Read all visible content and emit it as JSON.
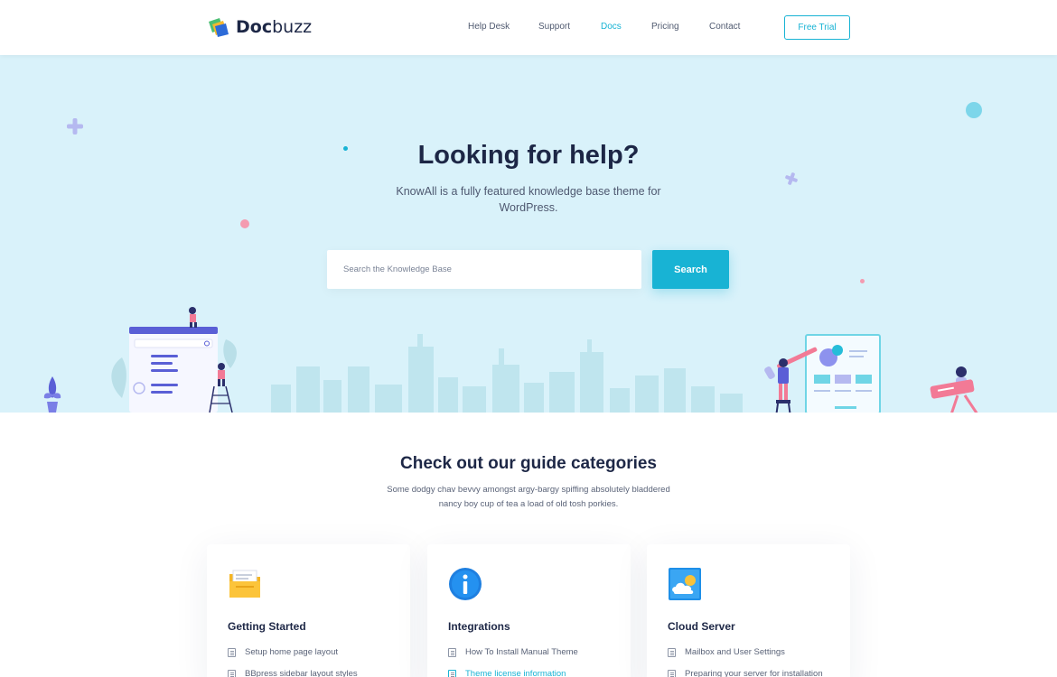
{
  "brand": {
    "name_bold": "Doc",
    "name_rest": "buzz"
  },
  "nav": {
    "items": [
      {
        "label": "Help Desk"
      },
      {
        "label": "Support"
      },
      {
        "label": "Docs",
        "active": true
      },
      {
        "label": "Pricing"
      },
      {
        "label": "Contact"
      }
    ],
    "cta_label": "Free Trial"
  },
  "hero": {
    "title": "Looking for help?",
    "subtitle": "KnowAll is a fully featured knowledge base theme for WordPress.",
    "search_placeholder": "Search the Knowledge Base",
    "search_button": "Search"
  },
  "categories": {
    "title": "Check out our guide categories",
    "subtitle": "Some dodgy chav bevvy amongst argy-bargy spiffing absolutely bladdered nancy boy cup of tea a load of old tosh porkies.",
    "cards": [
      {
        "icon": "folder-icon",
        "title": "Getting Started",
        "items": [
          {
            "label": "Setup home page layout",
            "link": false
          },
          {
            "label": "BBpress sidebar layout styles",
            "link": false
          }
        ]
      },
      {
        "icon": "info-icon",
        "title": "Integrations",
        "items": [
          {
            "label": "How To Install Manual Theme",
            "link": false
          },
          {
            "label": "Theme license information",
            "link": true
          }
        ]
      },
      {
        "icon": "cloud-icon",
        "title": "Cloud Server",
        "items": [
          {
            "label": "Mailbox and User Settings",
            "link": false
          },
          {
            "label": "Preparing your server for installation",
            "link": false
          }
        ]
      }
    ]
  },
  "colors": {
    "accent": "#18b3d4",
    "hero_bg": "#d9f2fa",
    "heading": "#1d2746"
  }
}
